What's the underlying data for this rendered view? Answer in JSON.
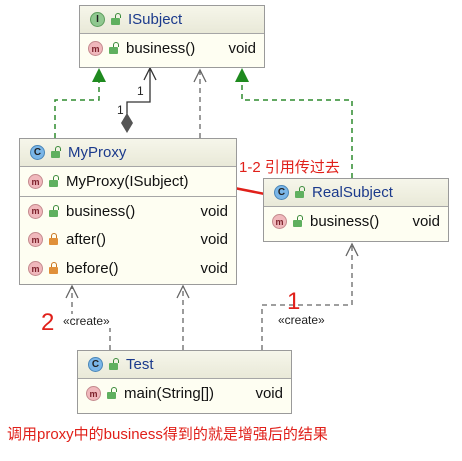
{
  "isubject": {
    "badge": "I",
    "name": "ISubject",
    "methods": [
      {
        "name": "business()",
        "type": "void"
      }
    ]
  },
  "myproxy": {
    "badge": "C",
    "name": "MyProxy",
    "constructor": {
      "name": "MyProxy(ISubject)"
    },
    "methods": [
      {
        "name": "business()",
        "type": "void"
      },
      {
        "name": "after()",
        "type": "void"
      },
      {
        "name": "before()",
        "type": "void"
      }
    ]
  },
  "realsubject": {
    "badge": "C",
    "name": "RealSubject",
    "methods": [
      {
        "name": "business()",
        "type": "void"
      }
    ]
  },
  "test": {
    "badge": "C",
    "name": "Test",
    "methods": [
      {
        "name": "main(String[])",
        "type": "void"
      }
    ]
  },
  "method_badge": "m",
  "labels": {
    "multiplicity_top": "1",
    "multiplicity_side": "1",
    "create_left": "«create»",
    "create_right": "«create»",
    "step1_2": "1-2 引用传过去",
    "step1": "1",
    "step2": "2",
    "footer": "调用proxy中的business得到的就是增强后的结果"
  },
  "colors": {
    "annotation": "#e0201a",
    "inherit_arrow": "#2e8b2e",
    "dashed": "#2e8b2e"
  }
}
